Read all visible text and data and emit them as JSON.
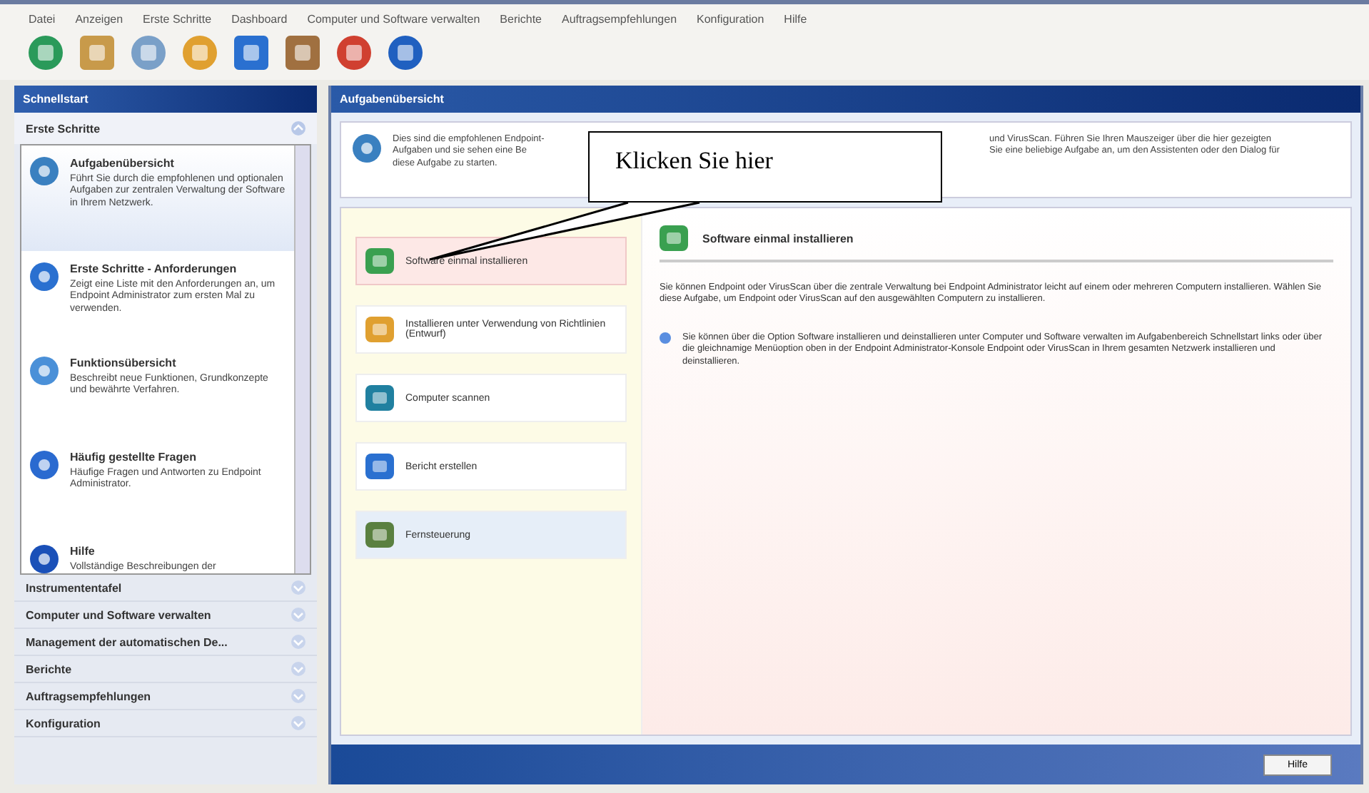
{
  "menu": [
    "Datei",
    "Anzeigen",
    "Erste Schritte",
    "Dashboard",
    "Computer und Software verwalten",
    "Berichte",
    "Auftragsempfehlungen",
    "Konfiguration",
    "Hilfe"
  ],
  "sidebar": {
    "title": "Schnellstart",
    "section": {
      "title": "Erste Schritte",
      "expanded": true,
      "items": [
        {
          "title": "Aufgabenübersicht",
          "text": "Führt Sie durch die empfohlenen und optionalen Aufgaben zur zentralen Verwaltung der Software in Ihrem Netzwerk.",
          "selected": true
        },
        {
          "title": "Erste Schritte - Anforderungen",
          "text": "Zeigt eine Liste mit den Anforderungen an, um Endpoint Administrator zum ersten Mal zu verwenden.",
          "selected": false
        },
        {
          "title": "Funktionsübersicht",
          "text": "Beschreibt neue Funktionen, Grundkonzepte und bewährte Verfahren.",
          "selected": false
        },
        {
          "title": "Häufig gestellte Fragen",
          "text": "Häufige Fragen und Antworten zu Endpoint Administrator.",
          "selected": false
        },
        {
          "title": "Hilfe",
          "text": "Vollständige Beschreibungen der",
          "selected": false
        }
      ]
    },
    "groups": [
      {
        "title": "Instrumententafel",
        "expanded": false
      },
      {
        "title": "Computer und Software verwalten",
        "expanded": false
      },
      {
        "title": "Management der automatischen De...",
        "expanded": false
      },
      {
        "title": "Berichte",
        "expanded": false
      },
      {
        "title": "Auftragsempfehlungen",
        "expanded": false
      },
      {
        "title": "Konfiguration",
        "expanded": false
      }
    ]
  },
  "main": {
    "title": "Aufgabenübersicht",
    "intro_left": [
      "Dies sind die empfohlenen Endpoint-",
      "Aufgaben und sie sehen eine Be",
      "diese Aufgabe zu starten."
    ],
    "intro_right": [
      "und VirusScan. Führen Sie Ihren Mauszeiger über die hier gezeigten",
      "Sie eine beliebige Aufgabe an, um den Assistenten oder den Dialog für"
    ],
    "tasks": [
      {
        "label": "Software einmal installieren",
        "selected": true
      },
      {
        "label": "Installieren unter Verwendung von Richtlinien (Entwurf)",
        "selected": false
      },
      {
        "label": "Computer scannen",
        "selected": false
      },
      {
        "label": "Bericht erstellen",
        "selected": false
      },
      {
        "label": "Fernsteuerung",
        "selected": false
      }
    ],
    "detail": {
      "title": "Software einmal installieren",
      "text": "Sie können Endpoint oder VirusScan über die zentrale Verwaltung bei Endpoint Administrator leicht auf einem oder mehreren Computern installieren. Wählen Sie diese Aufgabe, um Endpoint oder VirusScan auf den ausgewählten Computern zu installieren.",
      "tip": "Sie können über die Option Software installieren und deinstallieren unter Computer und Software verwalten im Aufgabenbereich Schnellstart links oder über die gleichnamige Menüoption oben in der Endpoint Administrator-Konsole Endpoint oder VirusScan in Ihrem gesamten Netzwerk installieren und deinstallieren."
    },
    "help_button": "Hilfe"
  },
  "callout": "Klicken Sie hier"
}
